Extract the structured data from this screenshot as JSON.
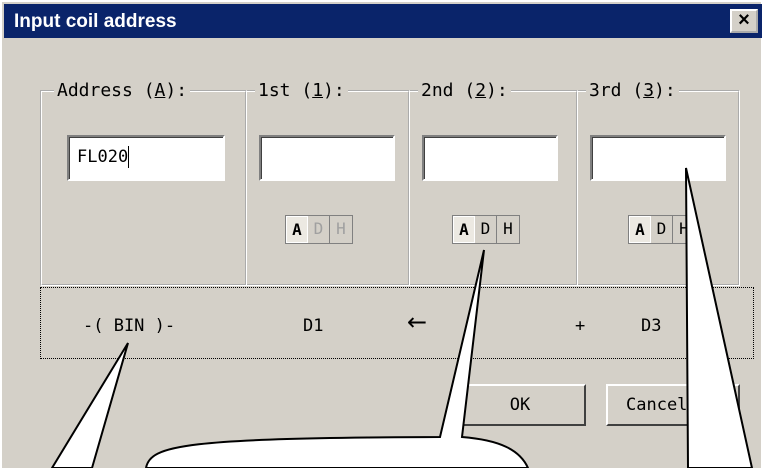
{
  "window": {
    "title": "Input coil address",
    "close_glyph": "×"
  },
  "groups": [
    {
      "legend_pre": "Address (",
      "legend_key": "A",
      "legend_post": "):",
      "value": "FL020"
    },
    {
      "legend_pre": "1st (",
      "legend_key": "1",
      "legend_post": "):",
      "value": ""
    },
    {
      "legend_pre": "2nd (",
      "legend_key": "2",
      "legend_post": "):",
      "value": ""
    },
    {
      "legend_pre": "3rd (",
      "legend_key": "3",
      "legend_post": "):",
      "value": ""
    }
  ],
  "radix_buttons": [
    "A",
    "D",
    "H"
  ],
  "preview": {
    "instruction": "-( BIN )-",
    "op1": "D1",
    "arrow_icon": "left-arrow-icon",
    "plus": "+",
    "op3": "D3"
  },
  "buttons": {
    "ok": "OK",
    "cancel": "Cancel"
  },
  "colors": {
    "face": "#d4d0c8",
    "titlebar": "#0a246a",
    "title_text": "#ffffff"
  }
}
